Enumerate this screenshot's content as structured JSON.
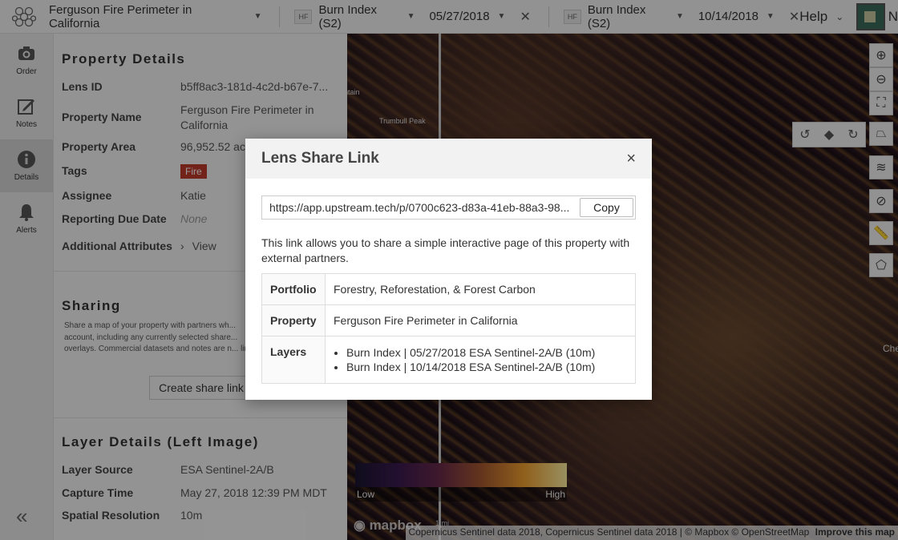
{
  "topbar": {
    "project_name": "Ferguson Fire Perimeter in California",
    "left_layer": {
      "badge": "HF",
      "name": "Burn Index (S2)",
      "date": "05/27/2018"
    },
    "right_layer": {
      "badge": "HF",
      "name": "Burn Index (S2)",
      "date": "10/14/2018"
    },
    "help_label": "Help",
    "user_initial": "N"
  },
  "rail": {
    "items": [
      {
        "label": "Order",
        "icon": "camera-icon"
      },
      {
        "label": "Notes",
        "icon": "edit-icon"
      },
      {
        "label": "Details",
        "icon": "info-icon"
      },
      {
        "label": "Alerts",
        "icon": "bell-icon"
      }
    ],
    "collapse_glyph": "«"
  },
  "details": {
    "title": "Property Details",
    "rows": [
      {
        "label": "Lens ID",
        "value": "b5ff8ac3-181d-4c2d-b67e-7..."
      },
      {
        "label": "Property Name",
        "value": "Ferguson Fire Perimeter in California"
      },
      {
        "label": "Property Area",
        "value": "96,952.52 ac"
      },
      {
        "label": "Tags",
        "value": "Fire"
      },
      {
        "label": "Assignee",
        "value": "Katie"
      },
      {
        "label": "Reporting Due Date",
        "value": "None"
      },
      {
        "label": "Additional Attributes",
        "value": "View"
      }
    ]
  },
  "sharing": {
    "title": "Sharing",
    "text": "Share a map of your property with partners wh... account, including any currently selected share... overlays. Commercial datasets and notes are n... link.",
    "button_label": "Create share link"
  },
  "layer_details": {
    "title": "Layer Details (Left Image)",
    "rows": [
      {
        "label": "Layer Source",
        "value": "ESA Sentinel-2A/B"
      },
      {
        "label": "Capture Time",
        "value": "May 27, 2018 12:39 PM MDT"
      },
      {
        "label": "Spatial Resolution",
        "value": "10m"
      }
    ]
  },
  "map": {
    "legend_low": "Low",
    "legend_high": "High",
    "scale_label": "1 mi",
    "mapbox_label": "mapbox",
    "attribution": "Copernicus Sentinel data 2018, Copernicus Sentinel data 2018 | © Mapbox © OpenStreetMap",
    "attribution_link": "Improve this map",
    "labels": [
      "ntain",
      "Trumbull Peak",
      "Che"
    ]
  },
  "modal": {
    "title": "Lens Share Link",
    "close_glyph": "×",
    "link": "https://app.upstream.tech/p/0700c623-d83a-41eb-88a3-98...",
    "copy_label": "Copy",
    "description": "This link allows you to share a simple interactive page of this property with external partners.",
    "table": {
      "portfolio_label": "Portfolio",
      "portfolio_value": "Forestry, Reforestation, & Forest Carbon",
      "property_label": "Property",
      "property_value": "Ferguson Fire Perimeter in California",
      "layers_label": "Layers",
      "layers": [
        "Burn Index | 05/27/2018 ESA Sentinel-2A/B (10m)",
        "Burn Index | 10/14/2018 ESA Sentinel-2A/B (10m)"
      ]
    }
  },
  "colors": {
    "tag_fire": "#c0392b",
    "overlay": "rgba(0,0,0,0.4)"
  }
}
